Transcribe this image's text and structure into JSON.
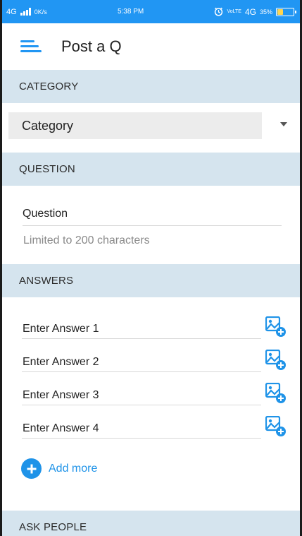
{
  "status_bar": {
    "network": "4G",
    "speed": "0K/s",
    "time": "5:38 PM",
    "volte": "VoLTE",
    "network_right": "4G",
    "battery_level": "35%",
    "battery_fraction": 0.35
  },
  "toolbar": {
    "title": "Post a Q",
    "menu_icon": "menu-icon"
  },
  "sections": {
    "category": "CATEGORY",
    "question": "QUESTION",
    "answers": "ANSWERS",
    "ask_people": "ASK PEOPLE"
  },
  "category": {
    "selected": "Category"
  },
  "question": {
    "placeholder": "Question",
    "helper": "Limited to 200 characters"
  },
  "answers": {
    "fields": [
      {
        "placeholder": "Enter Answer 1"
      },
      {
        "placeholder": "Enter Answer 2"
      },
      {
        "placeholder": "Enter Answer 3"
      },
      {
        "placeholder": "Enter Answer 4"
      }
    ],
    "add_more": "Add more"
  },
  "colors": {
    "accent": "#2196f3",
    "section_bg": "#d5e4ee",
    "link": "#1f93e8"
  }
}
